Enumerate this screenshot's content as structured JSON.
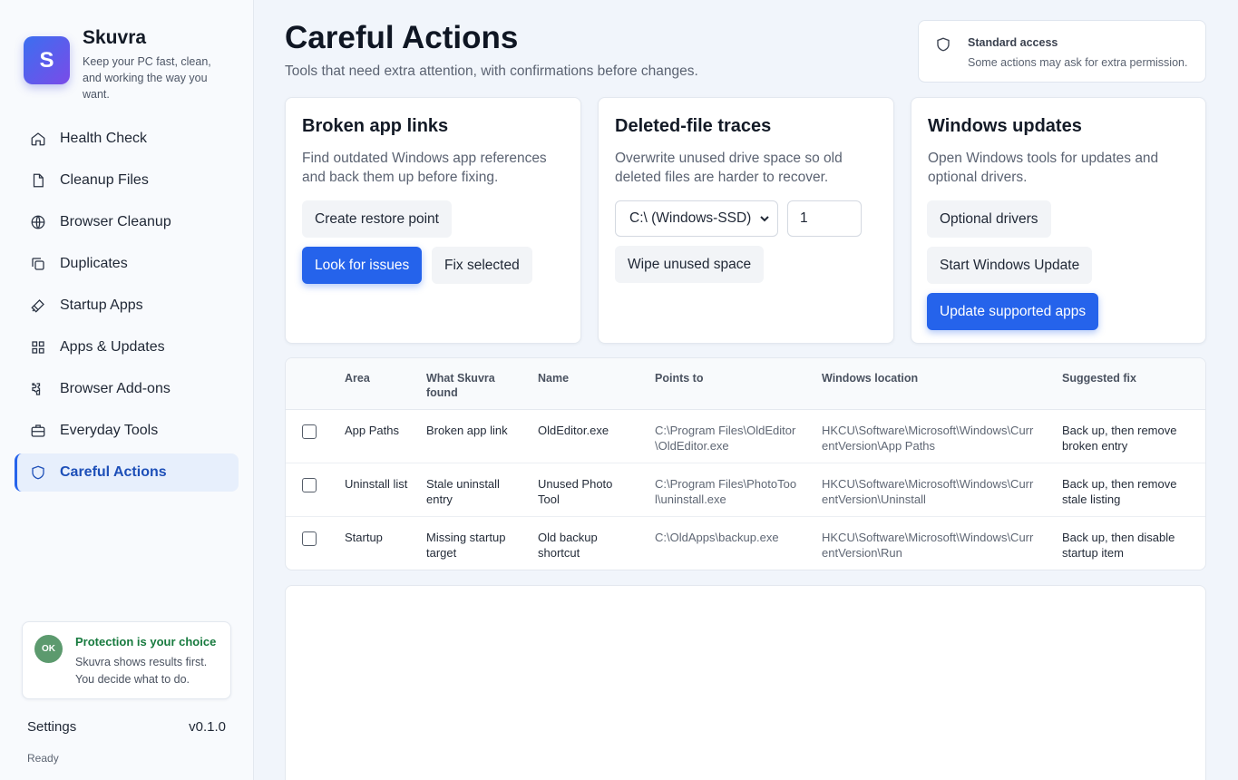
{
  "brand": {
    "logo_letter": "S",
    "name": "Skuvra",
    "tagline": "Keep your PC fast, clean, and working the way you want."
  },
  "nav": [
    {
      "label": "Health Check",
      "icon": "home-icon"
    },
    {
      "label": "Cleanup Files",
      "icon": "file-icon"
    },
    {
      "label": "Browser Cleanup",
      "icon": "globe-icon"
    },
    {
      "label": "Duplicates",
      "icon": "copy-icon"
    },
    {
      "label": "Startup Apps",
      "icon": "rocket-icon"
    },
    {
      "label": "Apps & Updates",
      "icon": "grid-icon"
    },
    {
      "label": "Browser Add-ons",
      "icon": "puzzle-icon"
    },
    {
      "label": "Everyday Tools",
      "icon": "briefcase-icon"
    },
    {
      "label": "Careful Actions",
      "icon": "shield-icon",
      "active": true
    }
  ],
  "protection": {
    "badge": "OK",
    "title": "Protection is your choice",
    "text": "Skuvra shows results first. You decide what to do."
  },
  "footer": {
    "settings_label": "Settings",
    "version": "v0.1.0",
    "status": "Ready"
  },
  "header": {
    "title": "Careful Actions",
    "subtitle": "Tools that need extra attention, with confirmations before changes."
  },
  "access": {
    "title": "Standard access",
    "text": "Some actions may ask for extra permission."
  },
  "cards": {
    "broken_links": {
      "title": "Broken app links",
      "desc": "Find outdated Windows app references and back them up before fixing.",
      "restore_label": "Create restore point",
      "look_label": "Look for issues",
      "fix_label": "Fix selected"
    },
    "traces": {
      "title": "Deleted-file traces",
      "desc": "Overwrite unused drive space so old deleted files are harder to recover.",
      "drive_value": "C:\\ (Windows-SSD)",
      "passes_value": "1",
      "wipe_label": "Wipe unused space"
    },
    "updates": {
      "title": "Windows updates",
      "desc": "Open Windows tools for updates and optional drivers.",
      "drivers_label": "Optional drivers",
      "start_label": "Start Windows Update",
      "apps_label": "Update supported apps"
    }
  },
  "table": {
    "headers": [
      "Area",
      "What Skuvra found",
      "Name",
      "Points to",
      "Windows location",
      "Suggested fix"
    ],
    "rows": [
      {
        "area": "App Paths",
        "found": "Broken app link",
        "name": "OldEditor.exe",
        "points_to": "C:\\Program Files\\OldEditor\\OldEditor.exe",
        "location": "HKCU\\Software\\Microsoft\\Windows\\CurrentVersion\\App Paths",
        "fix": "Back up, then remove broken entry"
      },
      {
        "area": "Uninstall list",
        "found": "Stale uninstall entry",
        "name": "Unused Photo Tool",
        "points_to": "C:\\Program Files\\PhotoTool\\uninstall.exe",
        "location": "HKCU\\Software\\Microsoft\\Windows\\CurrentVersion\\Uninstall",
        "fix": "Back up, then remove stale listing"
      },
      {
        "area": "Startup",
        "found": "Missing startup target",
        "name": "Old backup shortcut",
        "points_to": "C:\\OldApps\\backup.exe",
        "location": "HKCU\\Software\\Microsoft\\Windows\\CurrentVersion\\Run",
        "fix": "Back up, then disable startup item"
      }
    ]
  },
  "colors": {
    "accent": "#2563eb",
    "ok_green": "#177a3e",
    "background": "#f1f5fb"
  }
}
